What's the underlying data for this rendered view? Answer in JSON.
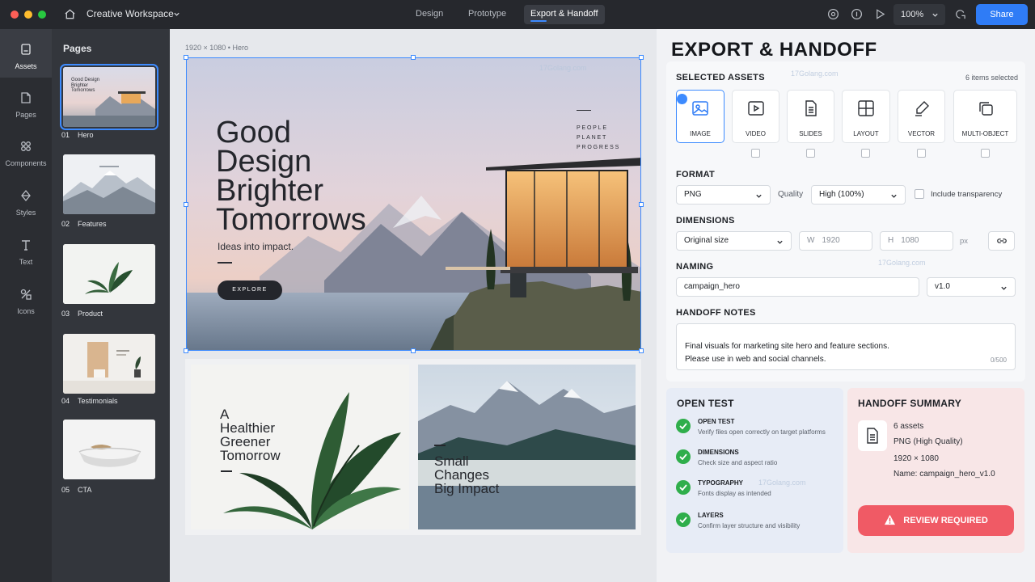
{
  "topbar": {
    "workspace": "Creative Workspace",
    "tabs": [
      {
        "label": "Design"
      },
      {
        "label": "Prototype"
      },
      {
        "label": "Export & Handoff"
      }
    ],
    "active_tab": "Export & Handoff",
    "zoom": "100%",
    "share_label": "Share"
  },
  "rail": {
    "items": [
      {
        "label": "Assets",
        "icon": "file-icon"
      },
      {
        "label": "Pages",
        "icon": "page-icon"
      },
      {
        "label": "Components",
        "icon": "components-icon"
      },
      {
        "label": "Styles",
        "icon": "droplet-icon"
      },
      {
        "label": "Text",
        "icon": "text-icon"
      },
      {
        "label": "Icons",
        "icon": "shapes-icon"
      }
    ],
    "active": "Assets"
  },
  "pages": {
    "title": "Pages",
    "items": [
      {
        "num": "01",
        "name": "Hero"
      },
      {
        "num": "02",
        "name": "Features"
      },
      {
        "num": "03",
        "name": "Product"
      },
      {
        "num": "04",
        "name": "Testimonials"
      },
      {
        "num": "05",
        "name": "CTA"
      }
    ],
    "thumb_hero_text": "Good Design Brighter Tomorrows"
  },
  "canvas": {
    "frame_label": "1920 × 1080 • Hero",
    "hero": {
      "title": "Good Design Brighter Tomorrows",
      "subtitle": "Ideas into impact.",
      "button": "EXPLORE",
      "tag": "PEOPLE PLANET PROGRESS"
    },
    "card1_text": "A\nHealthier\nGreener\nTomorrow",
    "card2_text": "Small\nChanges\nBig Impact"
  },
  "panel": {
    "title": "EXPORT & HANDOFF",
    "selected_assets_label": "SELECTED ASSETS",
    "selected_count": "6 items selected",
    "assets": [
      {
        "label": "IMAGE",
        "checked": true
      },
      {
        "label": "VIDEO",
        "checked": false
      },
      {
        "label": "SLIDES",
        "checked": false
      },
      {
        "label": "LAYOUT",
        "checked": false
      },
      {
        "label": "VECTOR",
        "checked": false
      },
      {
        "label": "MULTI-OBJECT",
        "checked": false
      }
    ],
    "format_label": "FORMAT",
    "format": "PNG",
    "quality_label": "Quality",
    "quality": "High (100%)",
    "transparency_label": "Include transparency",
    "transparency_checked": false,
    "dimensions_label": "DIMENSIONS",
    "size_mode": "Original size",
    "width_prefix": "W",
    "width": "1920",
    "height_prefix": "H",
    "height": "1080",
    "unit": "px",
    "naming_label": "NAMING",
    "file_name": "campaign_hero",
    "version": "v1.0",
    "notes_label": "HANDOFF NOTES",
    "notes": "Final visuals for marketing site hero and feature sections.\nPlease use in web and social channels.",
    "notes_count": "0/500"
  },
  "open_test": {
    "title": "OPEN TEST",
    "items": [
      {
        "title": "OPEN TEST",
        "desc": "Verify files open correctly on target platforms"
      },
      {
        "title": "DIMENSIONS",
        "desc": "Check size and aspect ratio"
      },
      {
        "title": "TYPOGRAPHY",
        "desc": "Fonts display as intended"
      },
      {
        "title": "LAYERS",
        "desc": "Confirm layer structure and visibility"
      }
    ]
  },
  "summary": {
    "title": "HANDOFF SUMMARY",
    "lines": [
      "6 assets",
      "PNG (High Quality)",
      "1920 × 1080",
      "Name: campaign_hero_v1.0"
    ],
    "review_label": "REVIEW REQUIRED"
  },
  "watermark": "17Golang.com",
  "colors": {
    "accent": "#2f7cf6",
    "success": "#2fae4b",
    "warning": "#f05a65",
    "topbar": "#26282d",
    "sidebar": "#33363c"
  }
}
